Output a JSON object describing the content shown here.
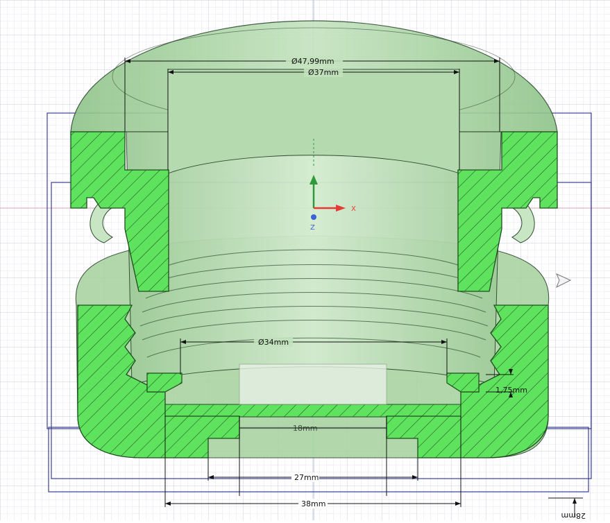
{
  "colors": {
    "background": "#ffffff",
    "grid_major": "#c8cbe4",
    "grid_minor": "#e4e6f3",
    "body": "#a9d3a3",
    "body_dark": "#8cbd86",
    "section": "#5fe35f",
    "outline": "#2f4a2f",
    "frame": "#3a3f96",
    "axis_x": "#e53935",
    "axis_y": "#2e9a3a",
    "axis_z": "#3b62d9"
  },
  "dimensions": {
    "outer_diameter": "Ø47,99mm",
    "inner_diameter": "Ø37mm",
    "seat_diameter": "Ø34mm",
    "lip_height": "1,75mm",
    "hidden_width": "18mm",
    "groove_width": "27mm",
    "base_width": "38mm",
    "mirrored_dim": "28mm"
  },
  "axes": {
    "x_label": "X",
    "z_label": "Z"
  }
}
